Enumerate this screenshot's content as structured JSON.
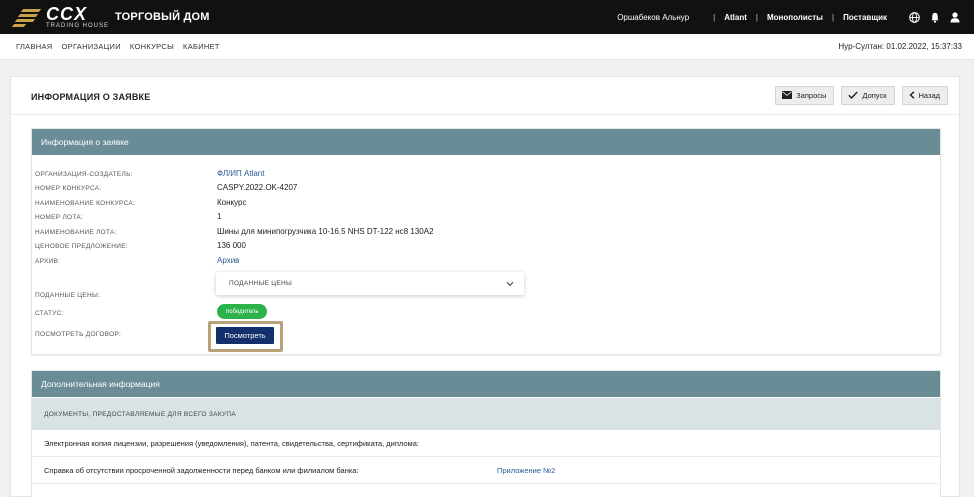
{
  "header": {
    "logo_text": "CCX",
    "logo_subtext": "TRADING HOUSE",
    "brand_title": "ТОРГОВЫЙ ДОМ",
    "user_name": "Оршабеков Альнур",
    "links": [
      "Atlant",
      "Монополисты",
      "Поставщик"
    ],
    "icons": [
      "globe-icon",
      "bell-icon",
      "user-icon"
    ]
  },
  "nav": {
    "items": [
      "ГЛАВНАЯ",
      "ОРГАНИЗАЦИИ",
      "КОНКУРСЫ",
      "КАБИНЕТ"
    ],
    "datetime": "Нур-Султан: 01.02.2022, 15:37:33"
  },
  "page": {
    "title": "ИНФОРМАЦИЯ О ЗАЯВКЕ",
    "buttons": {
      "requests": "Запросы",
      "admit": "Допуск",
      "back": "Назад"
    }
  },
  "info_section": {
    "title": "Информация о заявке",
    "org_label": "ОРГАНИЗАЦИЯ-СОЗДАТЕЛЬ:",
    "org_value": "ФЛ/ИП Atlant",
    "contest_no_label": "НОМЕР КОНКУРСА:",
    "contest_no_value": "CASPY.2022.OK-4207",
    "contest_name_label": "НАИМЕНОВАНИЕ КОНКУРСА:",
    "contest_name_value": "Конкурс",
    "lot_no_label": "НОМЕР ЛОТА:",
    "lot_no_value": "1",
    "lot_name_label": "НАИМЕНОВАНИЕ ЛОТА:",
    "lot_name_value": "Шины для минипогрузчика 10-16.5 NHS DT-122 нс8 130А2",
    "price_label": "ЦЕНОВОЕ ПРЕДЛОЖЕНИЕ:",
    "price_value": "136 000",
    "archive_label": "АРХИВ:",
    "archive_value": "Архив",
    "submitted_label": "ПОДАННЫЕ ЦЕНЫ:",
    "submitted_dropdown": "ПОДАННЫЕ ЦЕНЫ",
    "status_label": "СТАТУС:",
    "status_value": "победитель",
    "status_color": "#2bb34a",
    "contract_label": "ПОСМОТРЕТЬ ДОГОВОР:",
    "contract_button": "Посмотреть"
  },
  "additional_section": {
    "title": "Дополнительная информация",
    "docs_header": "ДОКУМЕНТЫ, ПРЕДОСТАВЛЯЕМЫЕ ДЛЯ ВСЕГО ЗАКУПА",
    "rows": [
      {
        "text": "Электронная копия лицензии, разрешения (уведомления), патента, свидетельства, сертификата, диплома:",
        "link": ""
      },
      {
        "text": "Справка об отсутствии просроченной задолженности перед банком или филиалом банка:",
        "link": "Приложение №2"
      }
    ]
  },
  "colors": {
    "topbar": "#111111",
    "section_bar": "#6a8c96",
    "primary_button": "#13306b",
    "link": "#2a5a94"
  }
}
